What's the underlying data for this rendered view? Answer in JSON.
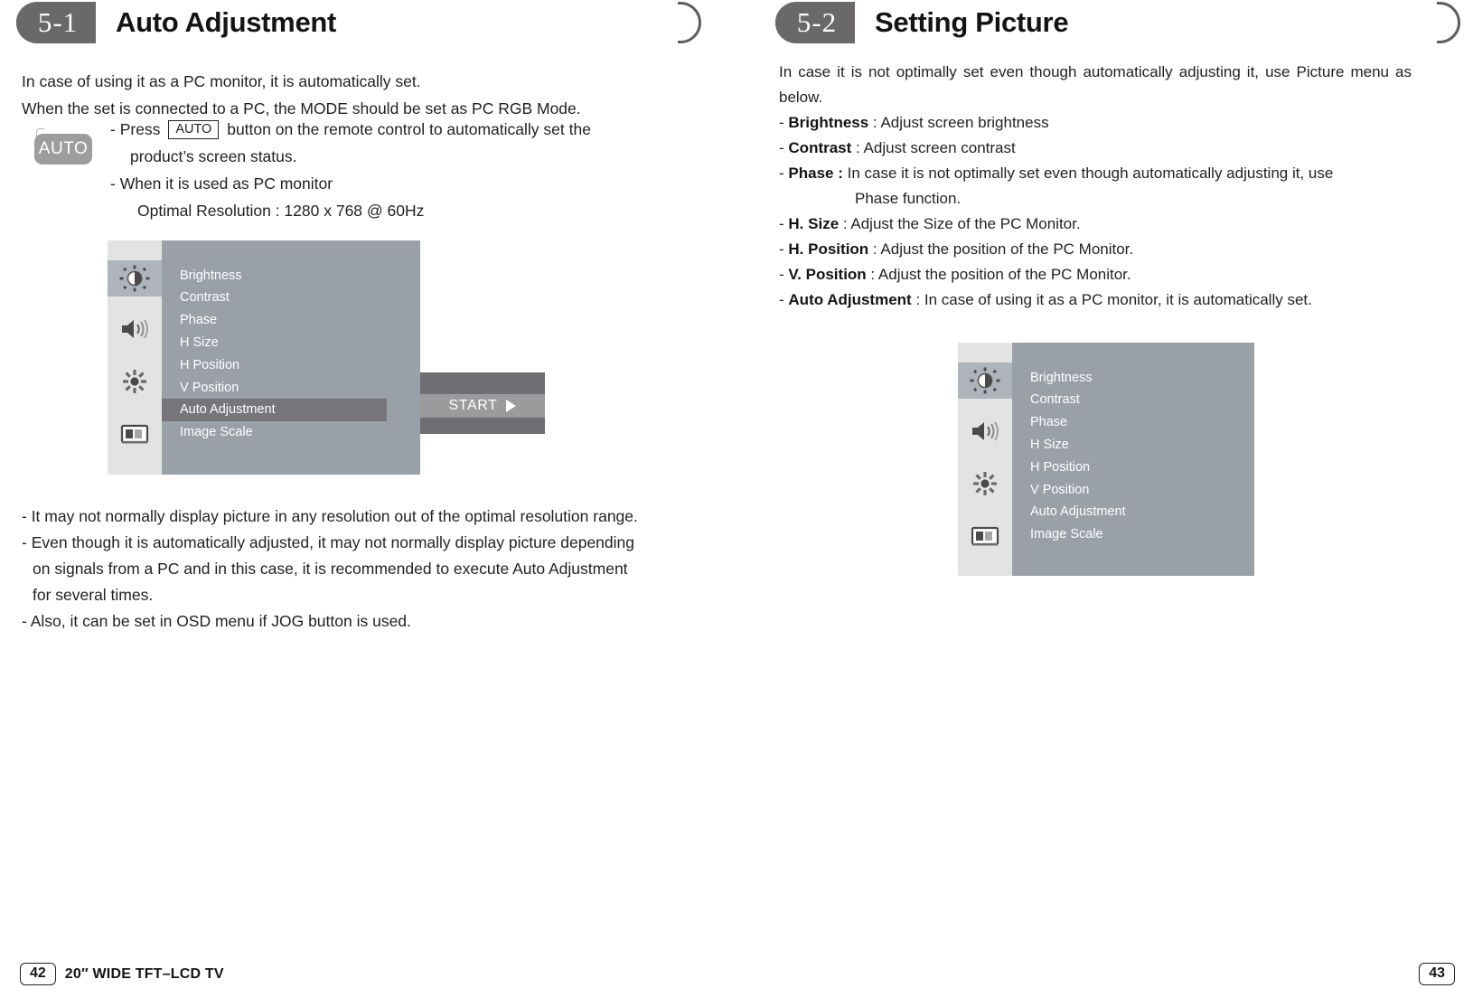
{
  "left_page": {
    "section_number": "5-1",
    "title": "Auto Adjustment",
    "intro_line_1": "In case of using it as a PC monitor, it is automatically set.",
    "intro_line_2": "When the set is connected to a PC, the MODE should be set as PC RGB Mode.",
    "auto_key_label": "AUTO",
    "press_prefix": "- Press",
    "press_inline_key": "AUTO",
    "press_suffix": "button on the remote control to automatically set the",
    "press_line_2": "product’s screen status.",
    "press_line_3": "- When it is used as PC monitor",
    "press_line_4": "Optimal Resolution : 1280 x 768 @ 60Hz",
    "notes": [
      "- It may not normally display picture in any resolution out of the optimal resolution range.",
      "- Even though it is automatically adjusted, it may not normally display picture depending",
      "on signals from a PC and in this case, it is recommended to execute Auto Adjustment",
      "for several times.",
      "- Also, it can be set in OSD menu if JOG button is used."
    ],
    "footer_page": "42",
    "footer_label": "20″ WIDE TFT–LCD TV"
  },
  "right_page": {
    "section_number": "5-2",
    "title": "Setting Picture",
    "intro": "In case it is not optimally set even though automatically adjusting it, use Picture menu as below.",
    "items": [
      {
        "dash": "-",
        "term": "Brightness",
        "sep": " : ",
        "desc": "Adjust screen brightness"
      },
      {
        "dash": "-",
        "term": "Contrast",
        "sep": " : ",
        "desc": "Adjust screen contrast"
      },
      {
        "dash": "-",
        "term": "Phase :",
        "sep": " ",
        "desc": "In case it is not optimally set even though automatically adjusting it, use",
        "cont": "Phase function."
      },
      {
        "dash": "-",
        "term": "H. Size",
        "sep": " : ",
        "desc": "Adjust the Size of the PC Monitor."
      },
      {
        "dash": "-",
        "term": "H. Position",
        "sep": " : ",
        "desc": "Adjust the position of the PC Monitor."
      },
      {
        "dash": "-",
        "term": "V. Position",
        "sep": " :  ",
        "desc": "Adjust the position of the PC Monitor."
      },
      {
        "dash": "-",
        "term": "Auto Adjustment",
        "sep": " : ",
        "desc": "In case of using it as a PC monitor, it is automatically set."
      }
    ],
    "footer_page": "43"
  },
  "osd": {
    "menu_items": [
      "Brightness",
      "Contrast",
      "Phase",
      "H Size",
      "H Position",
      "V Position",
      "Auto Adjustment",
      "Image Scale"
    ],
    "icons": [
      "brightness-icon",
      "speaker-icon",
      "setup-gear-icon",
      "image-scale-icon"
    ],
    "highlighted_item": "Auto Adjustment",
    "selected_icon": "brightness-icon",
    "start_label": "START",
    "colors": {
      "menu_bg": "#9aa0a8",
      "icon_col_bg": "#e3e3e3",
      "icon_selected_bg": "#aeb4bb",
      "highlight_bg": "#76767a",
      "start_panel_bg": "#6f6f73",
      "start_band_bg": "#9b9b9e",
      "text": "#ffffff",
      "header_pill": "#6b6869"
    }
  }
}
